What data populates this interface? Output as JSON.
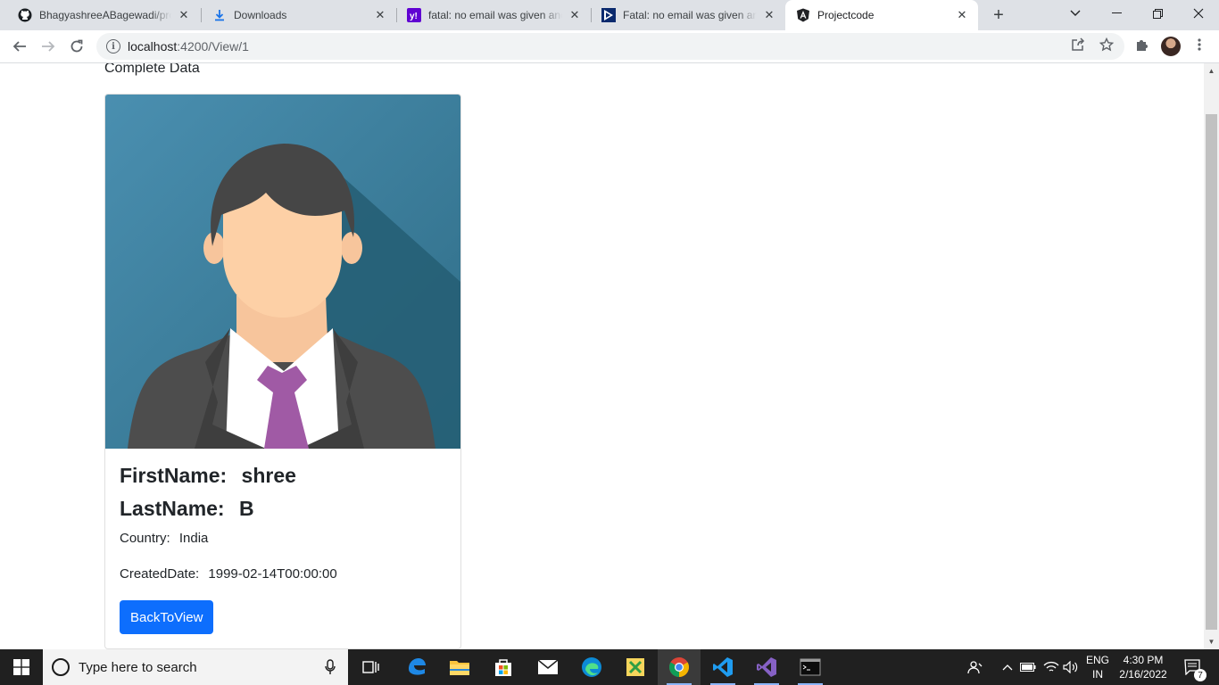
{
  "browser": {
    "tabs": [
      {
        "title": "BhagyashreeABagewadi/proj",
        "icon": "github-icon",
        "active": false
      },
      {
        "title": "Downloads",
        "icon": "download-icon",
        "active": false
      },
      {
        "title": "fatal: no email was given and",
        "icon": "yahoo-answers-icon",
        "active": false
      },
      {
        "title": "Fatal: no email was given and",
        "icon": "azure-devops-icon",
        "active": false
      },
      {
        "title": "Projectcode",
        "icon": "angular-icon",
        "active": true
      }
    ],
    "url_host": "localhost",
    "url_path": ":4200/View/1"
  },
  "page": {
    "heading": "Complete Data",
    "profile": {
      "first_name_label": "FirstName:",
      "first_name": "shree",
      "last_name_label": "LastName:",
      "last_name": "B",
      "country_label": "Country:",
      "country": "India",
      "created_label": "CreatedDate:",
      "created_date": "1999-02-14T00:00:00"
    },
    "back_button": "BackToView"
  },
  "taskbar": {
    "search_placeholder": "Type here to search",
    "lang_top": "ENG",
    "lang_bottom": "IN",
    "time": "4:30 PM",
    "date": "2/16/2022",
    "notification_count": "7"
  },
  "colors": {
    "primary_button": "#0d6efd",
    "avatar_bg": "#3f7f9a",
    "tie": "#a05aa5"
  }
}
